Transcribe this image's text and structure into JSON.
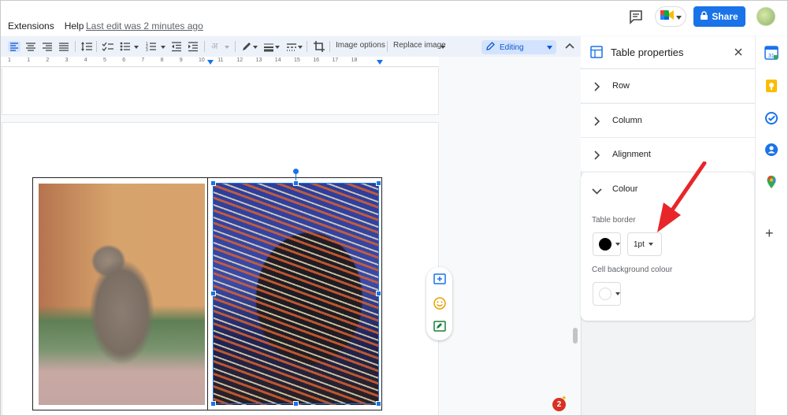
{
  "menu": {
    "items": [
      "Extensions",
      "Help"
    ],
    "last_edit": "Last edit was 2 minutes ago"
  },
  "header": {
    "share_label": "Share"
  },
  "toolbar": {
    "image_options": "Image options",
    "replace_image": "Replace image",
    "mode": "Editing",
    "font_glyph": "अ"
  },
  "ruler": {
    "ticks": [
      "1",
      "1",
      "2",
      "3",
      "4",
      "5",
      "6",
      "7",
      "8",
      "9",
      "10",
      "11",
      "12",
      "13",
      "14",
      "15",
      "16",
      "17",
      "18"
    ]
  },
  "side_panel": {
    "title": "Table properties",
    "sections": [
      {
        "label": "Row"
      },
      {
        "label": "Column"
      },
      {
        "label": "Alignment"
      },
      {
        "label": "Colour"
      }
    ],
    "colour": {
      "table_border_label": "Table border",
      "border_color": "#000000",
      "border_width": "1pt",
      "cell_background_label": "Cell background colour",
      "cell_background_color": "#ffffff"
    }
  },
  "notifications": {
    "badge_count": "2"
  },
  "colors": {
    "accent": "#1a73e8",
    "arrow": "#e8262a",
    "badge": "#d93025"
  }
}
